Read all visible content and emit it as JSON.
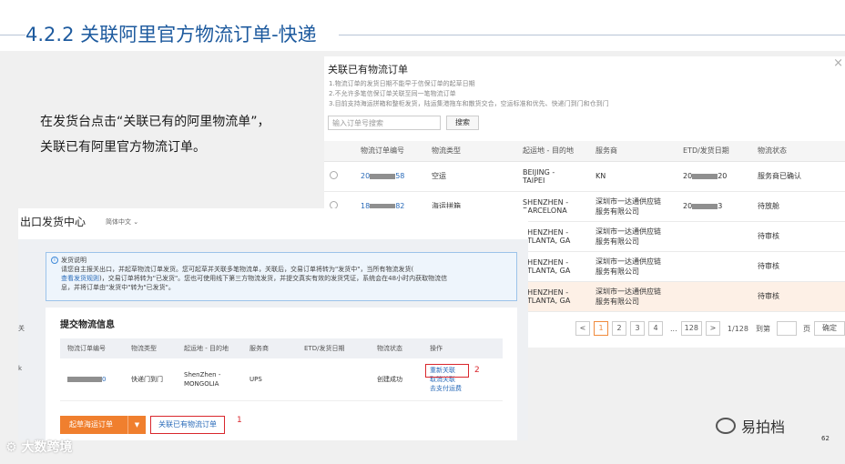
{
  "slide": {
    "title": "4.2.2 关联阿里官方物流订单-快递",
    "instruction_line1": "在发货台点击“关联已有的阿里物流单”，",
    "instruction_line2": "关联已有阿里官方物流订单。",
    "page_number": "62",
    "watermark_left": "大数跨境",
    "watermark_right": "易拍档"
  },
  "dialog": {
    "title": "关联已有物流订单",
    "close": "×",
    "notes": [
      "1.物流订单的发货日期不能早于信保订单的起草日期",
      "2.不允许多笔信保订单关联至同一笔物流订单",
      "3.目前支持海运拼箱和整柜发货，陆运集港拖车和散货交合，空运标准和优先、快递门到门和仓到门"
    ],
    "search_placeholder": "输入订单号搜索",
    "search_button": "搜索",
    "columns": [
      "物流订单编号",
      "物流类型",
      "起运地 - 目的地",
      "服务商",
      "ETD/发货日期",
      "物流状态"
    ],
    "rows": [
      {
        "id_prefix": "20",
        "id_suffix": "58",
        "type": "空运",
        "route1": "BEIJING -",
        "route2": "TAIPEI",
        "provider1": "KN",
        "provider2": "",
        "etd_prefix": "20",
        "etd_suffix": "20",
        "status": "服务商已确认"
      },
      {
        "id_prefix": "18",
        "id_suffix": "82",
        "type": "海运拼箱",
        "route1": "SHENZHEN -",
        "route2": "BARCELONA",
        "provider1": "深圳市一达通供应链",
        "provider2": "服务有限公司",
        "etd_prefix": "20",
        "etd_suffix": "3",
        "status": "待放舱"
      },
      {
        "id_prefix": "",
        "id_suffix": "",
        "type": "",
        "route1": "SHENZHEN -",
        "route2": "ATLANTA, GA",
        "provider1": "深圳市一达通供应链",
        "provider2": "服务有限公司",
        "etd_prefix": "",
        "etd_suffix": "",
        "status": "待审核"
      },
      {
        "id_prefix": "",
        "id_suffix": "",
        "type": "",
        "route1": "SHENZHEN -",
        "route2": "ATLANTA, GA",
        "provider1": "深圳市一达通供应链",
        "provider2": "服务有限公司",
        "etd_prefix": "",
        "etd_suffix": "",
        "status": "待审核"
      },
      {
        "id_prefix": "",
        "id_suffix": "",
        "type": "",
        "route1": "SHENZHEN -",
        "route2": "ATLANTA, GA",
        "provider1": "深圳市一达通供应链",
        "provider2": "服务有限公司",
        "etd_prefix": "",
        "etd_suffix": "",
        "status": "待审核"
      }
    ],
    "pager": {
      "prev": "<",
      "pages": [
        "1",
        "2",
        "3",
        "4"
      ],
      "ellipsis": "...",
      "last": "128",
      "next": ">",
      "current_total": "1/128",
      "goto_label": "到第",
      "page_unit": "页",
      "confirm": "确定"
    }
  },
  "panel": {
    "app_title": "出口发货中心",
    "language": "简体中文",
    "side_chars": [
      "关",
      "k"
    ],
    "notice": {
      "icon": "i",
      "title": "发货说明",
      "line1": "请您自主报关出口，并起草物流订单发货。您可起草并关联多笔物流单，关联后，交易订单将转为\"发货中\"，当所有物流发货(",
      "link": "查看发货规则",
      "line2": ")，交易订单将转为\"已发货\"。您也可使用线下第三方物流发货，并提交真实有效的发货凭证，系统会在48小时内获取物流信",
      "line3": "息，并将订单由\"发货中\"转为\"已发货\"。"
    },
    "section_title": "提交物流信息",
    "columns": [
      "物流订单编号",
      "物流类型",
      "起运地 - 目的地",
      "服务商",
      "ETD/发货日期",
      "物流状态",
      "操作"
    ],
    "row": {
      "id_suffix": "0",
      "type": "快递门到门",
      "route1": "ShenZhen -",
      "route2": "MONGOLIA",
      "provider": "UPS",
      "etd": "",
      "status": "创建成功",
      "action1": "重新关联",
      "action2": "取消关联",
      "action3": "去支付运费"
    },
    "redraft_button": "起草海运订单",
    "relate_link": "关联已有物流订单",
    "mark1": "1",
    "mark2": "2"
  },
  "colors": {
    "title_blue": "#1d5a9e",
    "accent_orange": "#f07f2e",
    "highlight_red": "#d9262c",
    "link_blue": "#2a6bb9"
  }
}
